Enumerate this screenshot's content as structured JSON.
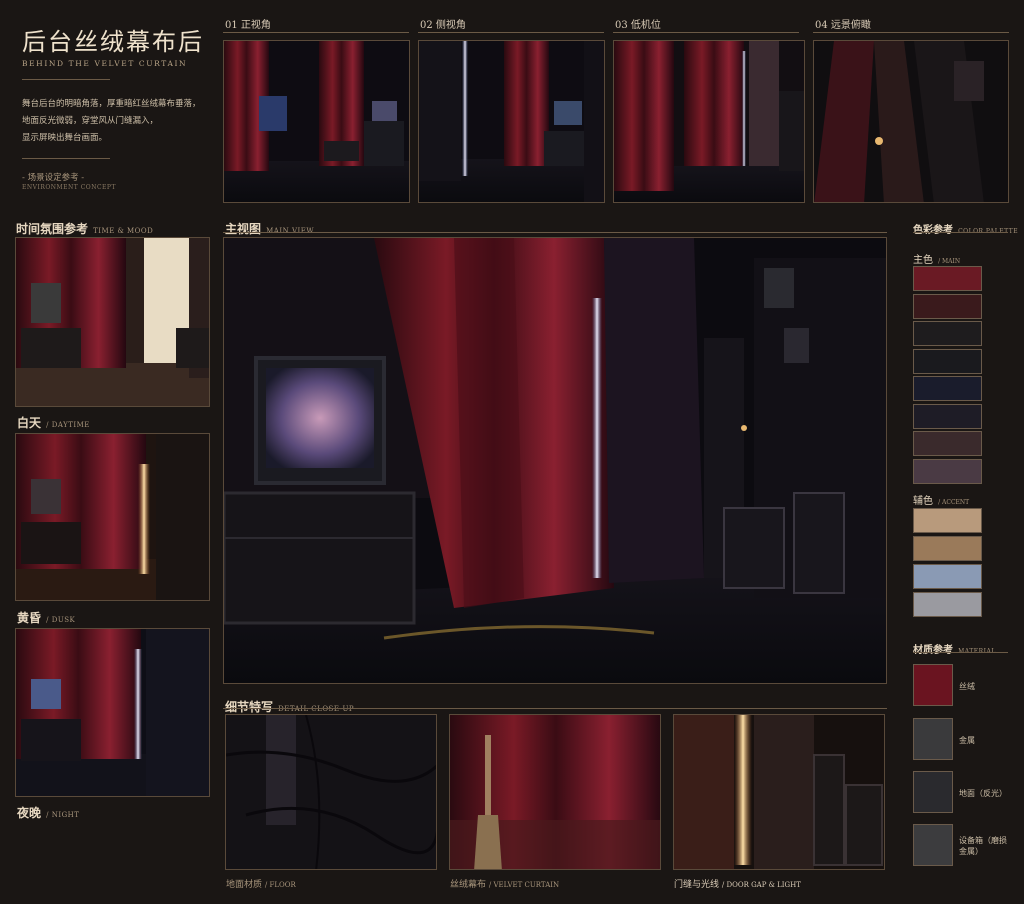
{
  "header": {
    "title": "后台丝绒幕布后",
    "subtitle": "BEHIND THE VELVET CURTAIN",
    "description": [
      "舞台后台的明暗角落，厚重暗红丝绒幕布垂落，",
      "地面反光微弱，穿堂风从门缝漏入，",
      "显示屏映出舞台画面。"
    ],
    "setting_cn": "- 场景设定参考 -",
    "setting_en": "ENVIRONMENT CONCEPT"
  },
  "views": [
    {
      "num": "01",
      "label": "正视角"
    },
    {
      "num": "02",
      "label": "侧视角"
    },
    {
      "num": "03",
      "label": "低机位"
    },
    {
      "num": "04",
      "label": "远景俯瞰"
    }
  ],
  "mood": {
    "title_cn": "时间氛围参考",
    "title_en": "TIME & MOOD",
    "items": [
      {
        "cn": "白天",
        "en": "DAYTIME"
      },
      {
        "cn": "黄昏",
        "en": "DUSK"
      },
      {
        "cn": "夜晚",
        "en": "NIGHT"
      }
    ]
  },
  "main": {
    "title_cn": "主视图",
    "title_en": "MAIN VIEW"
  },
  "details": {
    "title_cn": "细节特写",
    "title_en": "DETAIL CLOSE-UP",
    "items": [
      {
        "cn": "地面材质",
        "en": "FLOOR"
      },
      {
        "cn": "丝绒幕布",
        "en": "VELVET CURTAIN"
      },
      {
        "cn": "门缝与光线",
        "en": "DOOR GAP & LIGHT"
      }
    ]
  },
  "palette": {
    "title_cn": "色彩参考",
    "title_en": "COLOR PALETTE",
    "main_cn": "主色",
    "main_en": "MAIN",
    "main_colors": [
      "#6a1a24",
      "#3a1a1c",
      "#1e1c1e",
      "#1a1a1e",
      "#1a1c2c",
      "#1e1c26",
      "#3a2a2c",
      "#4a3a44"
    ],
    "accent_cn": "辅色",
    "accent_en": "ACCENT",
    "accent_colors": [
      "#b89a7c",
      "#9a7a5a",
      "#8a9ab4",
      "#9a9aa0"
    ]
  },
  "material": {
    "title_cn": "材质参考",
    "title_en": "MATERIAL",
    "items": [
      {
        "label": "丝绒",
        "color": "#6a1420"
      },
      {
        "label": "金属",
        "color": "#3a3a3c"
      },
      {
        "label": "地面（反光）",
        "color": "#2a2a2e"
      },
      {
        "label": "设备箱（磨损金属）",
        "color": "#3c3c3e"
      }
    ]
  }
}
